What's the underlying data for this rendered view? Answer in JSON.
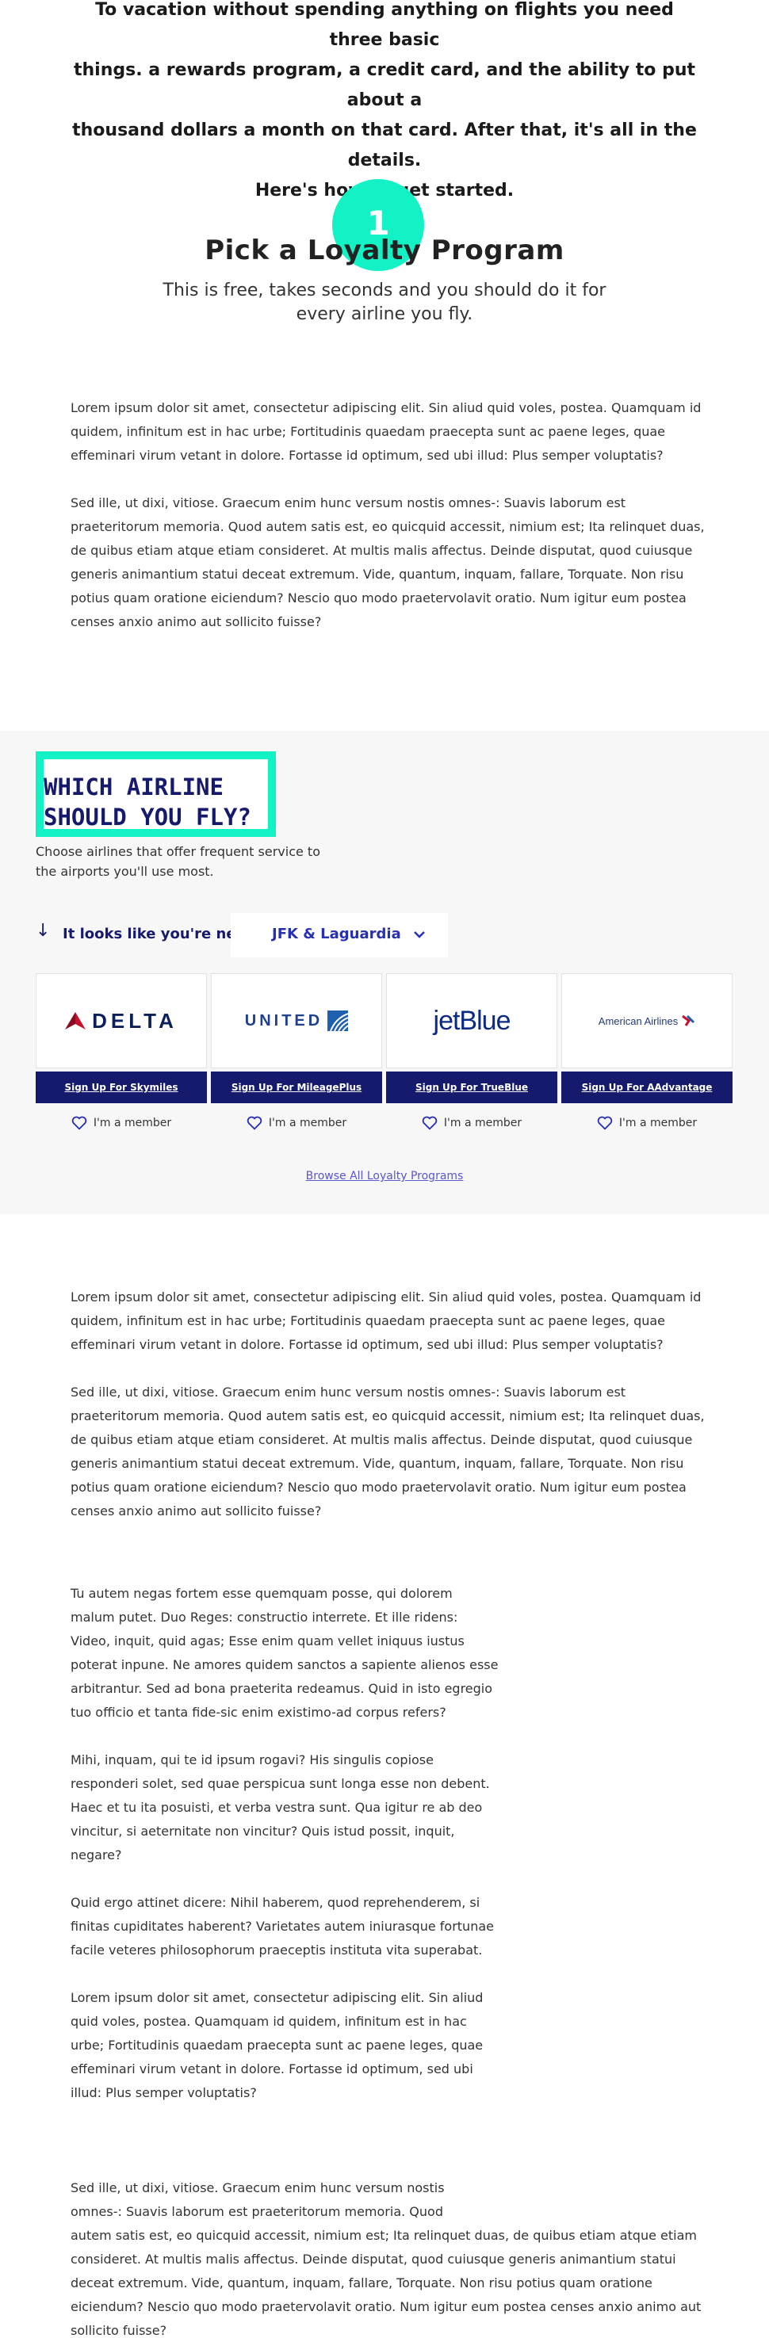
{
  "intro": {
    "lines": [
      "To vacation without spending anything on flights you need three basic",
      "things. a rewards program, a credit card, and the ability to put about a",
      "thousand dollars a month on that card. After that, it's all in the details.",
      "Here's how to get started."
    ]
  },
  "step": {
    "number": "1",
    "title": "Pick a Loyalty Program",
    "subtitle_lines": [
      "This is free, takes seconds and you should do it for",
      "every airline you fly."
    ]
  },
  "prose_top": [
    "Lorem ipsum dolor sit amet, consectetur adipiscing elit. Sin aliud quid voles, postea. Quamquam id quidem, infinitum est in hac urbe; Fortitudinis quaedam praecepta sunt ac paene leges, quae effeminari virum vetant in dolore. Fortasse id optimum, sed ubi illud: Plus semper voluptatis?",
    "Sed ille, ut dixi, vitiose. Graecum enim hunc versum nostis omnes-: Suavis laborum est praeteritorum memoria. Quod autem satis est, eo quicquid accessit, nimium est; Ita relinquet duas, de quibus etiam atque etiam consideret. At multis malis affectus. Deinde disputat, quod cuiusque generis animantium statui deceat extremum. Vide, quantum, inquam, fallare, Torquate. Non risu potius quam oratione eiciendum? Nescio quo modo praetervolavit oratio. Num igitur eum postea censes anxio animo aut sollicito fuisse?"
  ],
  "airline_section": {
    "heading_lines": [
      "WHICH AIRLINE",
      "SHOULD YOU FLY?"
    ],
    "description": "Choose airlines that offer frequent service to the airports you'll use most.",
    "near_label": "It looks like you're near",
    "location": "JFK & Laguardia",
    "cards": [
      {
        "logo": "DELTA",
        "signup": "Sign Up For Skymiles",
        "member": "I'm a member"
      },
      {
        "logo": "UNITED",
        "signup": "Sign Up For MileagePlus",
        "member": "I'm a member"
      },
      {
        "logo": "jetBlue",
        "signup": "Sign Up For TrueBlue",
        "member": "I'm a member"
      },
      {
        "logo": "American Airlines",
        "signup": "Sign Up For AAdvantage",
        "member": "I'm a member"
      }
    ],
    "browse_link": "Browse All Loyalty Programs",
    "colors": {
      "accent": "#13f2c4",
      "navy": "#151a6c",
      "link": "#5b55d0",
      "panel_bg": "#f7f7f7"
    }
  },
  "prose_mid": [
    "Lorem ipsum dolor sit amet, consectetur adipiscing elit. Sin aliud quid voles, postea. Quamquam id quidem, infinitum est in hac urbe; Fortitudinis quaedam praecepta sunt ac paene leges, quae effeminari virum vetant in dolore. Fortasse id optimum, sed ubi illud: Plus semper voluptatis?",
    "Sed ille, ut dixi, vitiose. Graecum enim hunc versum nostis omnes-: Suavis laborum est praeteritorum memoria. Quod autem satis est, eo quicquid accessit, nimium est; Ita relinquet duas, de quibus etiam atque etiam consideret. At multis malis affectus. Deinde disputat, quod cuiusque generis animantium statui deceat extremum. Vide, quantum, inquam, fallare, Torquate. Non risu potius quam oratione eiciendum? Nescio quo modo praetervolavit oratio. Num igitur eum postea censes anxio animo aut sollicito fuisse?"
  ],
  "prose_narrow": [
    "Tu autem negas fortem esse quemquam posse, qui dolorem malum putet. Duo Reges: constructio interrete. Et ille ridens: Video, inquit, quid agas; Esse enim quam vellet iniquus iustus poterat inpune. Ne amores quidem sanctos a sapiente alienos esse arbitrantur. Sed ad bona praeterita redeamus. Quid in isto egregio tuo officio et tanta fide-sic enim existimo-ad corpus refers?",
    "Mihi, inquam, qui te id ipsum rogavi? His singulis copiose responderi solet, sed quae perspicua sunt longa esse non debent. Haec et tu ita posuisti, et verba vestra sunt. Qua igitur re ab deo vincitur, si aeternitate non vincitur? Quis istud possit, inquit, negare?",
    "Quid ergo attinet dicere: Nihil haberem, quod reprehenderem, si finitas cupiditates haberent? Varietates autem iniurasque fortunae facile veteres philosophorum praeceptis instituta vita superabat.",
    "Lorem ipsum dolor sit amet, consectetur adipiscing elit. Sin aliud quid voles, postea. Quamquam id quidem, infinitum est in hac urbe; Fortitudinis quaedam praecepta sunt ac paene leges, quae effeminari virum vetant in dolore. Fortasse id optimum, sed ubi illud: Plus semper voluptatis?"
  ],
  "prose_bottom": {
    "narrow_part": "Sed ille, ut dixi, vitiose. Graecum enim hunc versum nostis omnes-: Suavis laborum est praeteritorum memoria. Quod",
    "wide_part": "autem satis est, eo quicquid accessit, nimium est; Ita relinquet duas, de quibus etiam atque etiam consideret. At multis malis affectus. Deinde disputat, quod cuiusque generis animantium statui deceat extremum. Vide, quantum, inquam, fallare, Torquate. Non risu potius quam oratione eiciendum? Nescio quo modo praetervolavit oratio. Num igitur eum postea censes anxio animo aut sollicito fuisse?"
  }
}
